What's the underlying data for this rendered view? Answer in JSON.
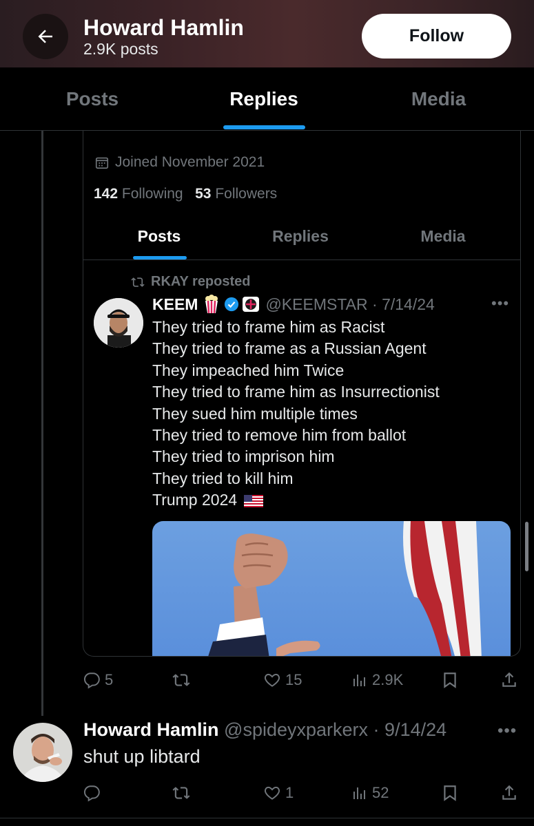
{
  "header": {
    "title": "Howard Hamlin",
    "subtitle": "2.9K posts",
    "follow_label": "Follow"
  },
  "tabs": [
    {
      "label": "Posts"
    },
    {
      "label": "Replies"
    },
    {
      "label": "Media"
    }
  ],
  "embedded_profile": {
    "joined": "Joined November 2021",
    "following_count": "142",
    "following_label": "Following",
    "followers_count": "53",
    "followers_label": "Followers",
    "tabs": [
      {
        "label": "Posts"
      },
      {
        "label": "Replies"
      },
      {
        "label": "Media"
      }
    ]
  },
  "embedded_post": {
    "repost_label": "RKAY reposted",
    "author_name": "KEEM",
    "author_handle": "@KEEMSTAR",
    "date": "7/14/24",
    "lines": [
      "They tried to frame him as Racist",
      "They tried to frame as a Russian Agent",
      "They impeached him Twice",
      "They tried to frame him as Insurrectionist",
      "They sued him multiple times",
      "They tried to remove him from ballot",
      "They tried to imprison him",
      "They tried to kill him",
      "Trump 2024"
    ]
  },
  "original_post_stats": {
    "replies": "5",
    "reposts": "",
    "likes": "15",
    "views": "2.9K"
  },
  "reply": {
    "author_name": "Howard Hamlin",
    "author_handle": "@spideyxparkerx",
    "date": "9/14/24",
    "text": "shut up libtard",
    "replies": "",
    "reposts": "",
    "likes": "1",
    "views": "52"
  },
  "colors": {
    "accent": "#1d9bf0",
    "muted": "#71767b",
    "background": "#000000"
  }
}
